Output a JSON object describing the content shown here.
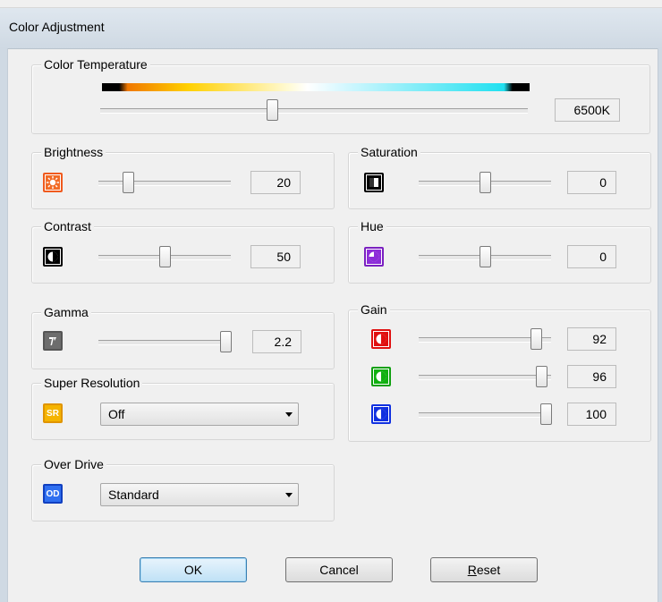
{
  "window": {
    "title": "Color Adjustment"
  },
  "color_temperature": {
    "label": "Color Temperature",
    "value_text": "6500K",
    "slider_fraction": 0.4
  },
  "brightness": {
    "label": "Brightness",
    "value_text": "20",
    "slider_fraction": 0.2,
    "icon": "brightness-icon",
    "icon_color": "#f05a1e"
  },
  "contrast": {
    "label": "Contrast",
    "value_text": "50",
    "slider_fraction": 0.5,
    "icon": "contrast-icon",
    "icon_color": "#000000"
  },
  "gamma": {
    "label": "Gamma",
    "value_text": "2.2",
    "slider_fraction": 1.0,
    "icon": "gamma-icon",
    "icon_color": "#6d6d6d"
  },
  "saturation": {
    "label": "Saturation",
    "value_text": "0",
    "slider_fraction": 0.5,
    "icon": "saturation-icon",
    "icon_color": "#000000"
  },
  "hue": {
    "label": "Hue",
    "value_text": "0",
    "slider_fraction": 0.5,
    "icon": "hue-icon",
    "icon_color": "#8c2cd8"
  },
  "gain": {
    "label": "Gain",
    "channels": [
      {
        "name": "red",
        "value_text": "92",
        "slider_fraction": 0.92,
        "icon": "red-gain-icon",
        "icon_color": "#e01010"
      },
      {
        "name": "green",
        "value_text": "96",
        "slider_fraction": 0.96,
        "icon": "green-gain-icon",
        "icon_color": "#10b010"
      },
      {
        "name": "blue",
        "value_text": "100",
        "slider_fraction": 1.0,
        "icon": "blue-gain-icon",
        "icon_color": "#1030e0"
      }
    ]
  },
  "super_resolution": {
    "label": "Super Resolution",
    "selected": "Off",
    "icon": "super-resolution-icon",
    "icon_text": "SR",
    "icon_color": "#f0a800"
  },
  "over_drive": {
    "label": "Over Drive",
    "selected": "Standard",
    "icon": "over-drive-icon",
    "icon_text": "OD",
    "icon_color": "#1f5ed8"
  },
  "buttons": {
    "ok": "OK",
    "cancel": "Cancel",
    "reset_first": "R",
    "reset_rest": "eset"
  }
}
